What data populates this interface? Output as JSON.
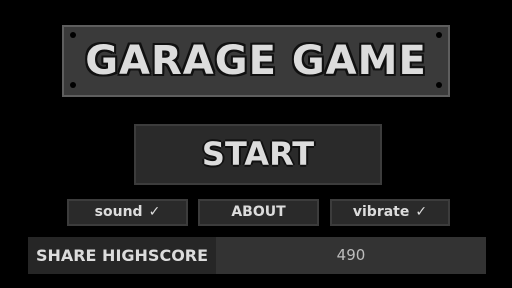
{
  "title": "GARAGE GAME",
  "menu": {
    "start_label": "START",
    "sound_label": "sound",
    "sound_check": "✓",
    "about_label": "ABOUT",
    "vibrate_label": "vibrate",
    "vibrate_check": "✓"
  },
  "share": {
    "label": "SHARE HIGHSCORE",
    "score": "490"
  },
  "colors": {
    "background": "#000000",
    "plate": "#3a3a3a",
    "button": "#2a2a2a",
    "text": "#dcdcdc"
  }
}
